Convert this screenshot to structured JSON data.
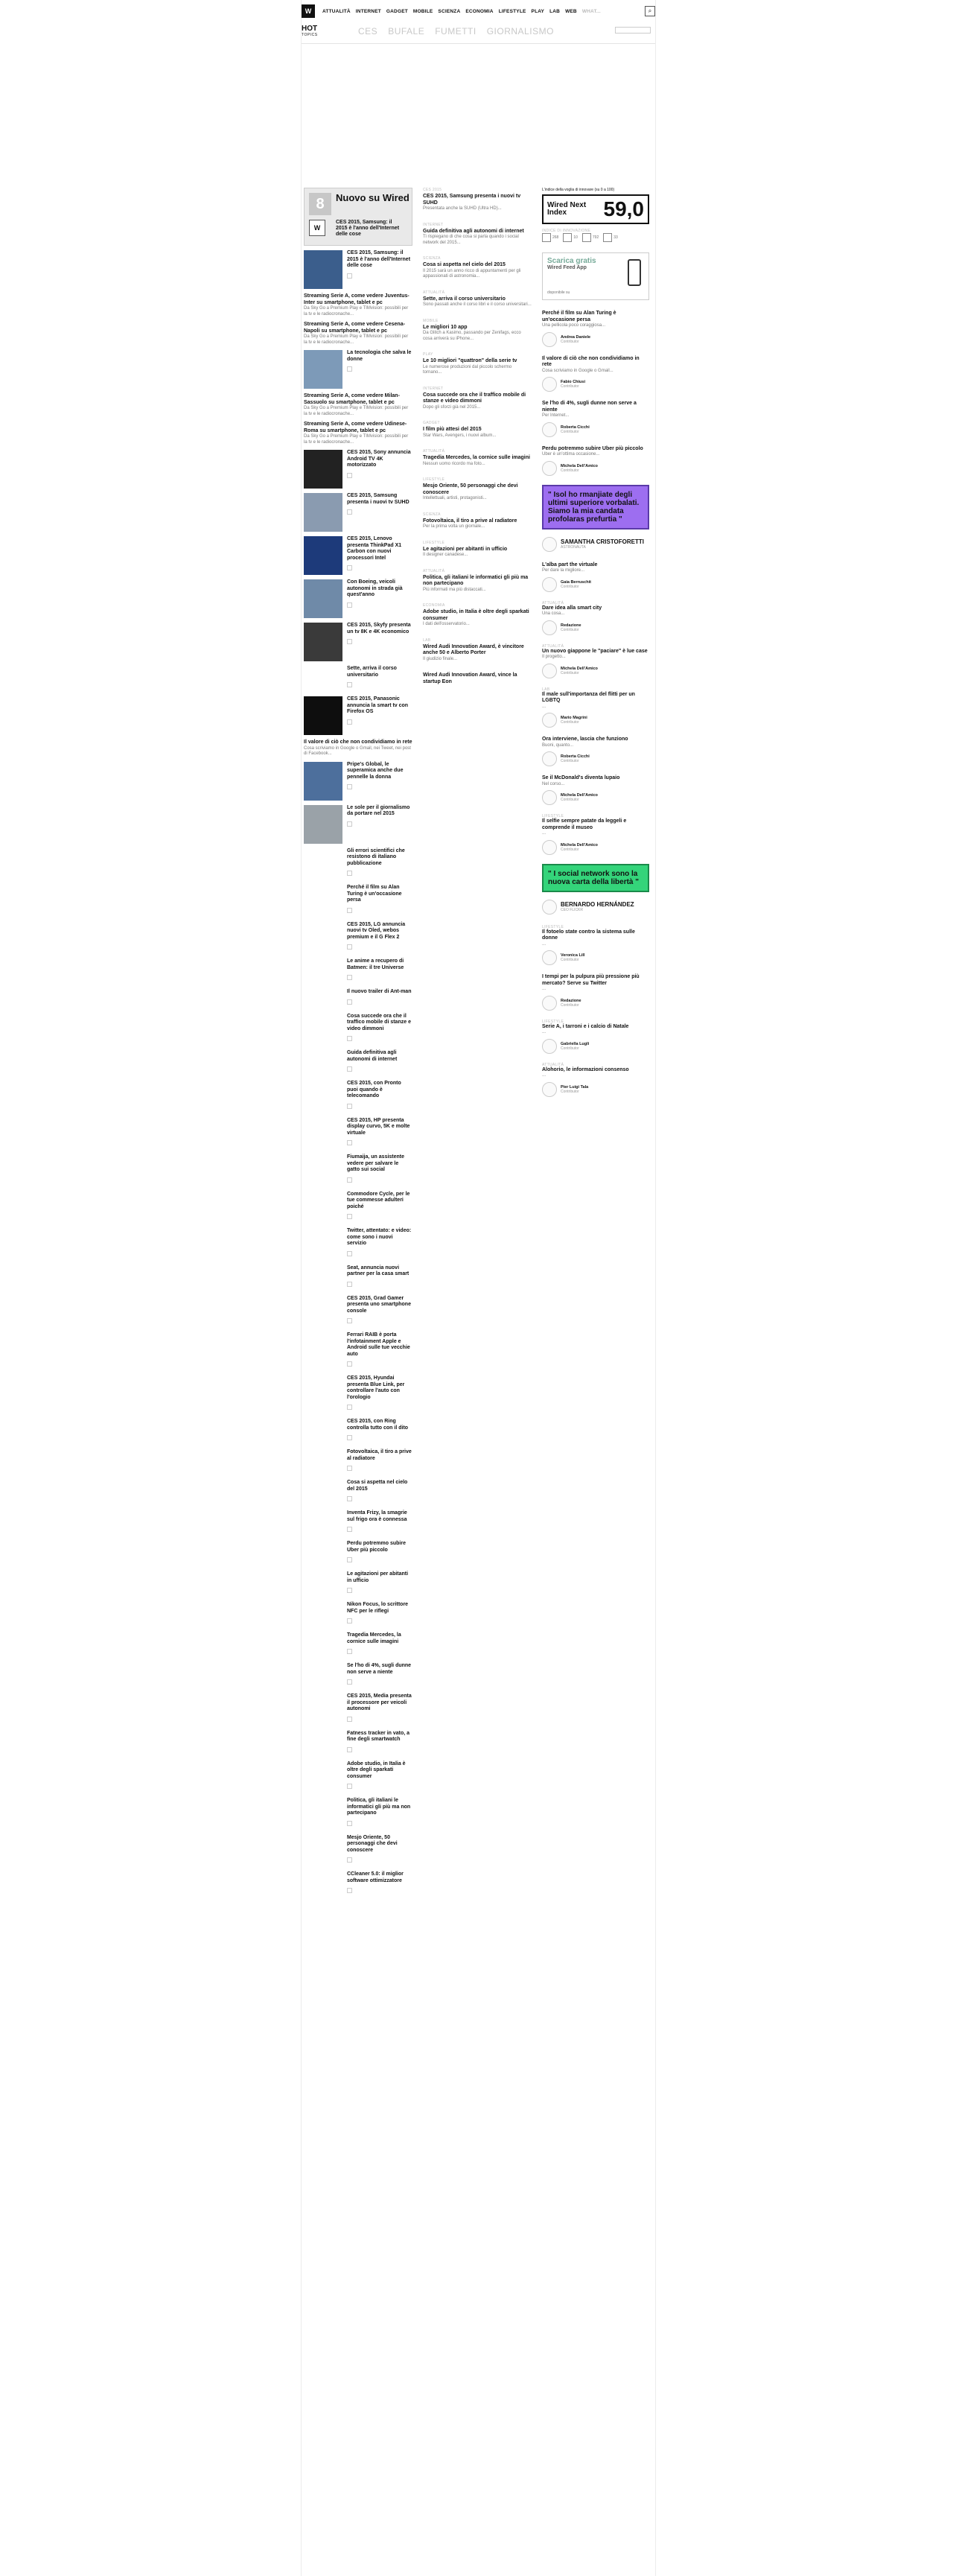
{
  "topnav": {
    "logo": "W",
    "links": [
      "ATTUALITÀ",
      "INTERNET",
      "GADGET",
      "MOBILE",
      "SCIENZA",
      "ECONOMIA",
      "LIFESTYLE",
      "PLAY",
      "LAB",
      "WEB",
      "WHAT..."
    ],
    "search_icon": "search-icon"
  },
  "hotbar": {
    "hot": "HOT",
    "topics_label": "TOPICS",
    "tags": [
      "CES",
      "BUFALE",
      "FUMETTI",
      "GIORNALISMO"
    ]
  },
  "nuovo": {
    "badge": "8",
    "title": "Nuovo su Wired",
    "thumb_letter": "W",
    "text": "CES 2015, Samsung: il 2015 è l'anno dell'Internet delle cose"
  },
  "left_items": [
    {
      "thumb": "#3b5e8c",
      "title": "CES 2015, Samsung: il 2015 è l'anno dell'Internet delle cose"
    },
    {
      "text_bold": "Streaming Serie A, come vedere Juventus-Inter su smartphone, tablet e pc",
      "text": "Da Sky Go a Premium Play e TIMvision: possibili per la tv e le radiocronache..."
    },
    {
      "text_bold": "Streaming Serie A, come vedere Cesena-Napoli su smartphone, tablet e pc",
      "text": "Da Sky Go a Premium Play e TIMvision: possibili per la tv e le radiocronache..."
    },
    {
      "thumb": "#7d9ab8",
      "title": "La tecnologia che salva le donne"
    },
    {
      "text_bold": "Streaming Serie A, come vedere Milan-Sassuolo su smartphone, tablet e pc",
      "text": "Da Sky Go a Premium Play e TIMvision: possibili per la tv e le radiocronache..."
    },
    {
      "text_bold": "Streaming Serie A, come vedere Udinese-Roma su smartphone, tablet e pc",
      "text": "Da Sky Go a Premium Play e TIMvision: possibili per la tv e le radiocronache..."
    },
    {
      "thumb": "#222222",
      "title": "CES 2015, Sony annuncia Android TV 4K motorizzato"
    },
    {
      "thumb": "#8a9bb0",
      "title": "CES 2015, Samsung presenta i nuovi tv SUHD"
    },
    {
      "thumb": "#1d3a7a",
      "title": "CES 2015, Lenovo presenta ThinkPad X1 Carbon con nuovi processori Intel"
    },
    {
      "thumb": "#6f8aa8",
      "title": "Con Boeing, veicoli autonomi in strada già quest'anno"
    },
    {
      "thumb": "#3a3a3a",
      "title": "CES 2015, Skyfy presenta un tv 8K e 4K economico"
    },
    {
      "title": "Sette, arriva il corso universitario"
    },
    {
      "thumb": "#0e0e0e",
      "title": "CES 2015, Panasonic annuncia la smart tv con Firefox OS"
    },
    {
      "text_bold": "Il valore di ciò che non condividiamo in rete",
      "text": "Cosa scriviamo in Google o Gmail, nei Tweet, nei post di Facebook..."
    },
    {
      "thumb": "#4d6f9c",
      "title": "Pripe's Global, le superamica anche due pennelle la donna"
    },
    {
      "thumb": "#9aa2a8",
      "title": "Le sole per il giornalismo da portare nel 2015"
    },
    {
      "title": "Gli errori scientifici che resistono di italiano pubblicazione"
    },
    {
      "title": "Perché il film su Alan Turing è un'occasione persa"
    },
    {
      "title": "CES 2015, LG annuncia nuovi tv Oled, webos premium e il G Flex 2"
    },
    {
      "title": "Le anime a recupero di Batmen: il tre Universe"
    },
    {
      "title": "Il nuovo trailer di Ant-man"
    },
    {
      "title": "Cosa succede ora che il traffico mobile di stanze e video dimmoni"
    },
    {
      "title": "Guida definitiva agli autonomi di internet"
    },
    {
      "title": "CES 2015, con Pronto puoi quando è telecomando"
    },
    {
      "title": "CES 2015, HP presenta display curvo, 5K e molte virtuale"
    },
    {
      "title": "Fiumaija, un assistente vedere per salvare le gatto sui social"
    },
    {
      "title": "Commodore Cycle, per le tue commesse adulteri poiché"
    },
    {
      "title": "Twitter, attentato: e video: come sono i nuovi servizio"
    },
    {
      "title": "Seat, annuncia nuovi partner per la casa smart"
    },
    {
      "title": "CES 2015, Grad Gamer presenta uno smartphone console"
    },
    {
      "title": "Ferrari RAIB è porta l'infotainment Apple e Android sulle tue vecchie auto"
    },
    {
      "title": "CES 2015, Hyundai presenta Blue Link, per controllare l'auto con l'orologio"
    },
    {
      "title": "CES 2015, con Ring controlla tutto con il dito"
    },
    {
      "title": "Fotovoltaica, il tiro a prive al radiatore"
    },
    {
      "title": "Cosa si aspetta nel cielo del 2015"
    },
    {
      "title": "Inventa Frizy, la smagrie sul frigo ora è connessa"
    },
    {
      "title": "Perdu potremmo subire Uber più piccolo"
    },
    {
      "title": "Le agitazioni per abitanti in ufficio"
    },
    {
      "title": "Nikon Focus, lo scrittore NFC per le riflegi"
    },
    {
      "title": "Tragedia Mercedes, la cornice sulle imagini"
    },
    {
      "title": "Se l'ho di 4%, sugli dunne non serve a niente"
    },
    {
      "title": "CES 2015, Media presenta il processore per veicoli autonomi"
    },
    {
      "title": "Fatness tracker in vato, a fine degli smartwatch"
    },
    {
      "title": "Adobe studio, in Italia è oltre degli sparkati consumer"
    },
    {
      "title": "Politica, gli italiani le informatici gli più ma non partecipano"
    },
    {
      "title": "Mesjo Oriente, 50 personaggi che devi conoscere"
    },
    {
      "title": "CCleaner 5.0: il miglior software ottimizzatore"
    }
  ],
  "mid_items": [
    {
      "meta": "CES 2015",
      "title": "CES 2015, Samsung presenta i nuovi tv SUHD",
      "text": "Presentata anche la SUHD (Ultra HD)..."
    },
    {
      "meta": "INTERNET",
      "title": "Guida definitiva agli autonomi di internet",
      "text": "Ti rispiegano di che cosa si parla quando i social network del 2015..."
    },
    {
      "meta": "SCIENZA",
      "title": "Cosa si aspetta nel cielo del 2015",
      "text": "Il 2015 sarà un anno ricco di appuntamenti per gli appassionati di astronomia..."
    },
    {
      "meta": "ATTUALITÀ",
      "title": "Sette, arriva il corso universitario",
      "text": "Sono passati anche il corso libri e il corso universitari..."
    },
    {
      "meta": "MOBILE",
      "title": "Le migliori 10 app",
      "text": "Da Glitch a Kasimo, passando per Zenifags, ecco cosa arriverà su iPhone..."
    },
    {
      "meta": "PLAY",
      "title": "Le 10 migliori \"quattron\" della serie tv",
      "text": "Le numerose produzioni dal piccolo schermo tornano..."
    },
    {
      "meta": "INTERNET",
      "title": "Cosa succede ora che il traffico mobile di stanze e video dimmoni",
      "text": "Dopo gli sforzi già nel 2015..."
    },
    {
      "meta": "GADGET",
      "title": "I film più attesi del 2015",
      "text": "Star Wars, Avengers, i nuovi album..."
    },
    {
      "meta": "ATTUALITÀ",
      "title": "Tragedia Mercedes, la cornice sulle imagini",
      "text": "Nessun uomo ricordo ma foto..."
    },
    {
      "meta": "LIFESTYLE",
      "title": "Mesjo Oriente, 50 personaggi che devi conoscere",
      "text": "Intellettuali, artisti, protagonisti..."
    },
    {
      "meta": "SCIENZA",
      "title": "Fotovoltaica, il tiro a prive al radiatore",
      "text": "Per la prima volta un giornale..."
    },
    {
      "meta": "LIFESTYLE",
      "title": "Le agitazioni per abitanti in ufficio",
      "text": "Il designer canadese..."
    },
    {
      "meta": "ATTUALITÀ",
      "title": "Politica, gli italiani le informatici gli più ma non partecipano",
      "text": "Più informati ma più distaccati..."
    },
    {
      "meta": "ECONOMIA",
      "title": "Adobe studio, in Italia è oltre degli sparkati consumer",
      "text": "I dati dell'osservatorio..."
    },
    {
      "meta": "LAB",
      "title": "Wired Audi Innovation Award, è vincitore anche 50 e Alberto Porter",
      "text": "Il giudizio finale..."
    },
    {
      "meta": "",
      "title": "Wired Audi Innovation Award, vince la startup Eon",
      "text": ""
    }
  ],
  "right": {
    "wni_caption": "L'indice della voglia di innovare (su 0 a 100)",
    "wni_label": "Wired Next Index",
    "wni_value": "59,0",
    "wni_meta": "INDICE DI INNOVAZIONE",
    "stats": [
      "268",
      "10",
      "792",
      "33"
    ],
    "app_title": "Scarica gratis",
    "app_sub": "Wired Feed App",
    "app_stores": "disponibile su",
    "items": [
      {
        "meta": "",
        "title": "Perché il film su Alan Turing è un'occasione persa",
        "text": "Una pellicola poco coraggiosa...",
        "author": "Andrea Daniele",
        "role": "Contributor"
      },
      {
        "meta": "",
        "title": "Il valore di ciò che non condividiamo in rete",
        "text": "Cosa scriviamo in Google o Gmail...",
        "author": "Fabio Chiusi",
        "role": "Contributor"
      },
      {
        "meta": "",
        "title": "Se l'ho di 4%, sugli dunne non serve a niente",
        "text": "Per Internet...",
        "author": "Roberta Cicchi",
        "role": "Contributor"
      },
      {
        "meta": "",
        "title": "Perdu potremmo subire Uber più piccolo",
        "text": "Uber è un'ottima occasione...",
        "author": "Michela Dell'Amico",
        "role": "Contributor"
      }
    ],
    "quote1": {
      "text": "\" Isol ho rmanjiate degli ultimi superiore vorbalati. Siamo la mia candata profolaras prefurtia \"",
      "name": "SAMANTHA CRISTOFORETTI",
      "role": "ASTRONAUTA"
    },
    "items2": [
      {
        "meta": "",
        "title": "L'alba part the virtuale",
        "text": "Per dare la migliore...",
        "author": "Gaia Berruschit",
        "role": "Contributor"
      },
      {
        "meta": "ATTUALITÀ",
        "title": "Dare idea alla smart city",
        "text": "Una cosa...",
        "author": "Redazione",
        "role": "Contributor"
      },
      {
        "meta": "ATTUALITÀ",
        "title": "Un nuovo giappone le \"paciare\" è lue case",
        "text": "Il progetto...",
        "author": "Michela Dell'Amico",
        "role": "Contributor"
      },
      {
        "meta": "LAB",
        "title": "Il male sull'importanza del flitti per un LGBTQ",
        "text": "...",
        "author": "Mario Magrini",
        "role": "Contributor"
      },
      {
        "meta": "",
        "title": "Ora interviene, lascia che funziono",
        "text": "Buoni, quanto...",
        "author": "Roberta Cicchi",
        "role": "Contributor"
      },
      {
        "meta": "",
        "title": "Se il McDonald's diventa lupaio",
        "text": "Nel corso...",
        "author": "Michela Dell'Amico",
        "role": "Contributor"
      },
      {
        "meta": "LIFESTYLE",
        "title": "Il selfie sempre patate da leggeli e comprende il museo",
        "text": "...",
        "author": "Michela Dell'Amico",
        "role": "Contributor"
      }
    ],
    "quote2": {
      "text": "\" I social network sono la nuova carta della libertà \"",
      "name": "BERNARDO HERNÁNDEZ",
      "role": "CEO FLICKR"
    },
    "items3": [
      {
        "meta": "LIFESTYLE",
        "title": "Il fotoelo state contro la sistema sulle donne",
        "text": "...",
        "author": "Veronica Lill",
        "role": "Contributor"
      },
      {
        "meta": "",
        "title": "I tempi per la pulpura più pressione più mercato? Serve su Twitter",
        "text": "...",
        "author": "Redazione",
        "role": "Contributor"
      },
      {
        "meta": "LIFESTYLE",
        "title": "Serie A, i tarroni e i calcio di Natale",
        "text": "...",
        "author": "Gabriella Lugli",
        "role": "Contributor"
      },
      {
        "meta": "ATTUALITÀ",
        "title": "Alohorio, le informazioni consenso",
        "text": "...",
        "author": "Pier Luigi Tala",
        "role": "Contributor"
      }
    ]
  }
}
